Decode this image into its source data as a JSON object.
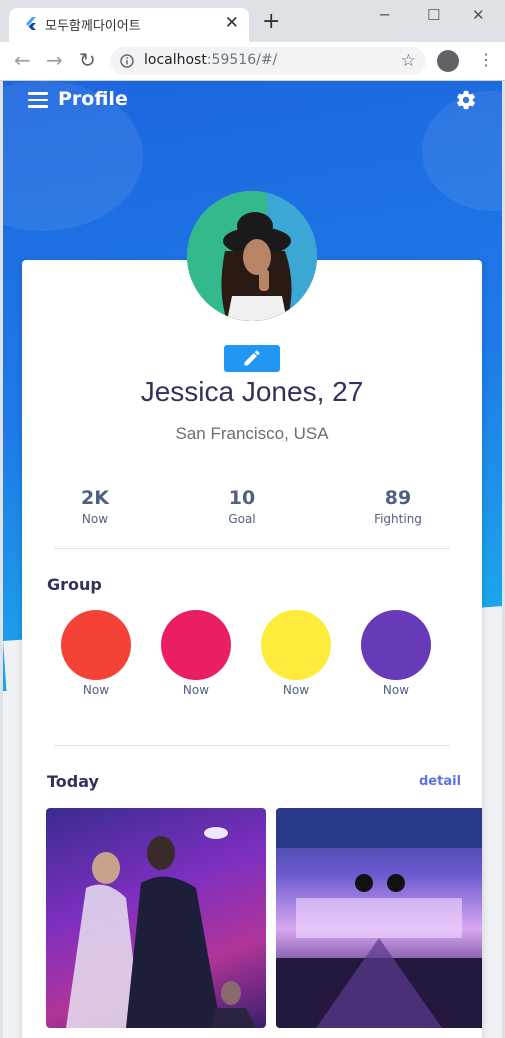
{
  "browser": {
    "tab_title": "모두함께다이어트",
    "url_host": "localhost",
    "url_rest": ":59516/#/"
  },
  "appbar": {
    "title": "Profile"
  },
  "profile": {
    "name": "Jessica Jones, 27",
    "location": "San Francisco, USA",
    "stats": [
      {
        "value": "2K",
        "label": "Now"
      },
      {
        "value": "10",
        "label": "Goal"
      },
      {
        "value": "89",
        "label": "Fighting"
      }
    ]
  },
  "group": {
    "heading": "Group",
    "items": [
      {
        "label": "Now",
        "color": "#f44336"
      },
      {
        "label": "Now",
        "color": "#e91e63"
      },
      {
        "label": "Now",
        "color": "#ffeb3b"
      },
      {
        "label": "Now",
        "color": "#673ab7"
      }
    ]
  },
  "today": {
    "heading": "Today",
    "detail_label": "detail"
  },
  "colors": {
    "primary": "#1e73e6",
    "accent": "#2196f3",
    "link": "#5e72e4"
  }
}
